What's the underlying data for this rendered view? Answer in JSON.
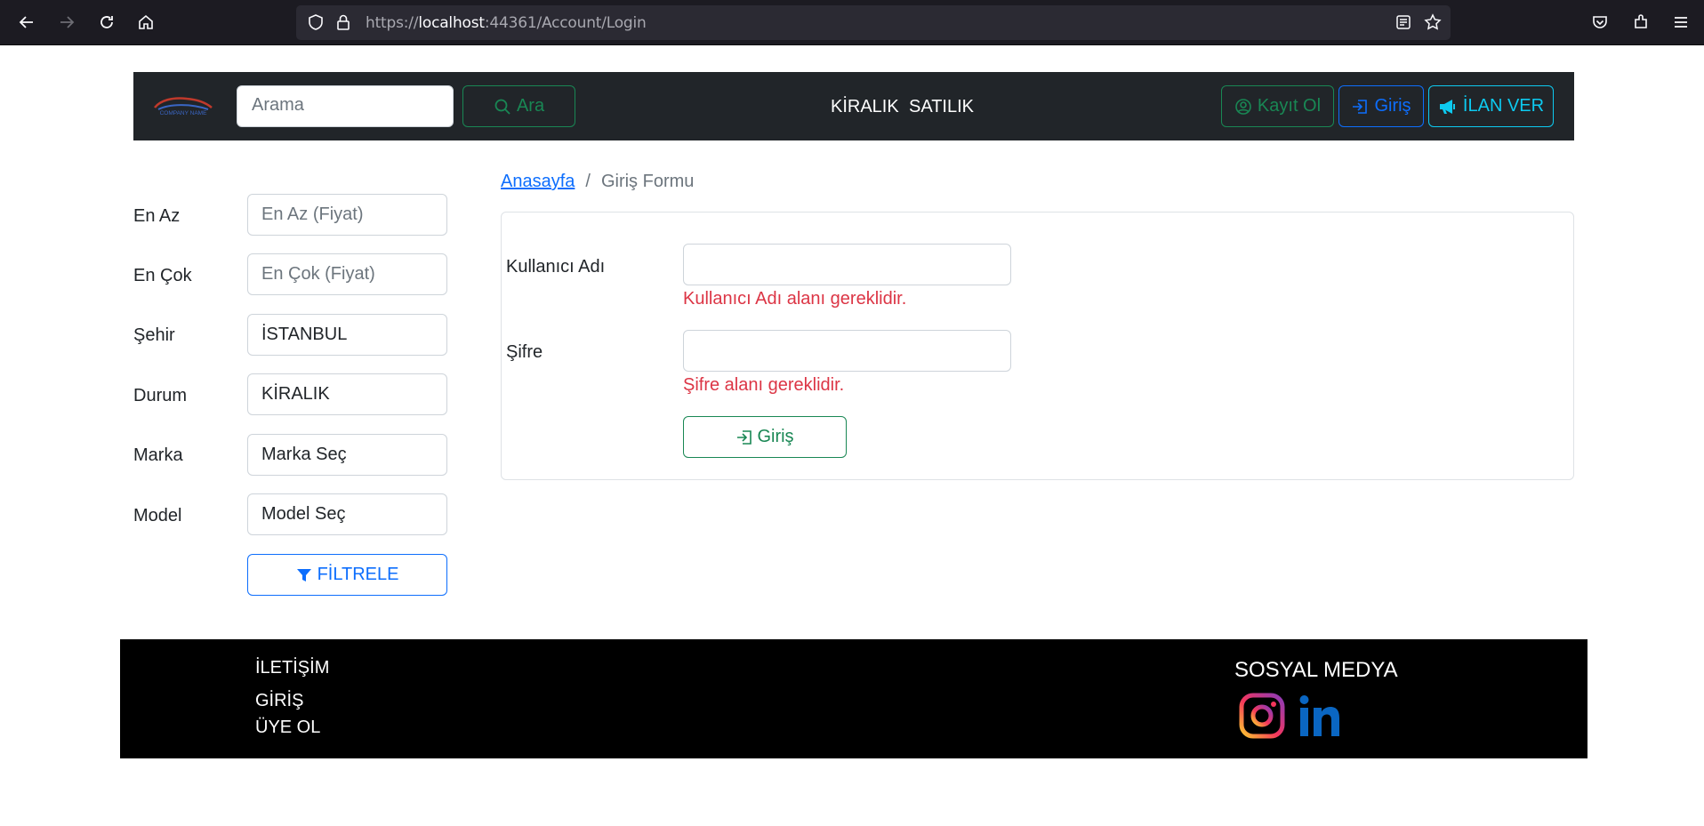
{
  "browser": {
    "url_prefix": "https://",
    "url_host": "localhost",
    "url_rest": ":44361/Account/Login"
  },
  "header": {
    "logo_text": "COMPANY NAME",
    "search_placeholder": "Arama",
    "search_button": "Ara",
    "nav_links": [
      "KİRALIK",
      "SATILIK"
    ],
    "register_button": "Kayıt Ol",
    "login_button": "Giriş",
    "ad_button": "İLAN VER"
  },
  "filters": {
    "min_label": "En Az",
    "min_placeholder": "En Az (Fiyat)",
    "max_label": "En Çok",
    "max_placeholder": "En Çok (Fiyat)",
    "city_label": "Şehir",
    "city_value": "İSTANBUL",
    "status_label": "Durum",
    "status_value": "KİRALIK",
    "brand_label": "Marka",
    "brand_value": "Marka Seç",
    "model_label": "Model",
    "model_value": "Model Seç",
    "filter_button": "FİLTRELE"
  },
  "breadcrumb": {
    "home": "Anasayfa",
    "separator": "/",
    "current": "Giriş Formu"
  },
  "login_form": {
    "username_label": "Kullanıcı Adı",
    "username_error": "Kullanıcı Adı alanı gereklidir.",
    "password_label": "Şifre",
    "password_error": "Şifre alanı gereklidir.",
    "submit_button": "Giriş"
  },
  "footer": {
    "links": [
      "İLETİŞİM",
      "GİRİŞ",
      "ÜYE OL"
    ],
    "social_title": "SOSYAL MEDYA"
  },
  "colors": {
    "navbar_bg": "#212529",
    "success": "#198754",
    "primary": "#0d6efd",
    "info": "#0dcaf0",
    "danger": "#dc3545"
  }
}
